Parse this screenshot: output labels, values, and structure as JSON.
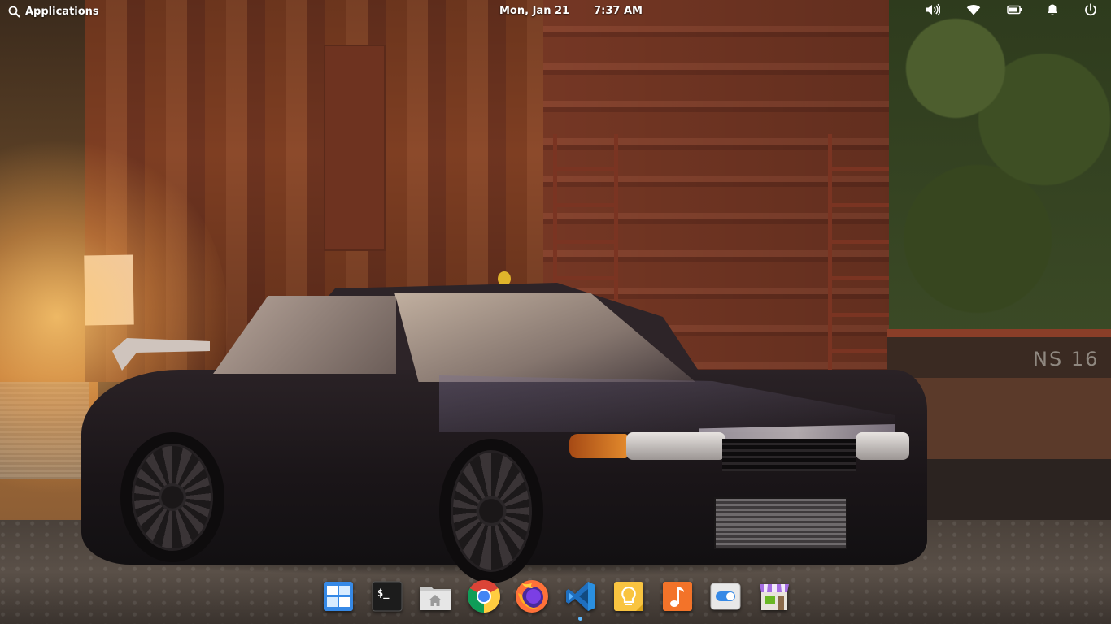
{
  "panel": {
    "applications_label": "Applications",
    "date": "Mon, Jan 21",
    "time": "7:37 AM",
    "indicators": [
      {
        "name": "volume-icon"
      },
      {
        "name": "wifi-icon"
      },
      {
        "name": "battery-icon"
      },
      {
        "name": "notifications-bell-icon"
      },
      {
        "name": "power-icon"
      }
    ]
  },
  "wallpaper": {
    "boxcar_marking": "NS 16"
  },
  "dock": {
    "items": [
      {
        "name": "multitasking-view",
        "icon": "multitasking-icon"
      },
      {
        "name": "terminal",
        "icon": "terminal-icon",
        "glyph": "$_"
      },
      {
        "name": "files",
        "icon": "files-home-folder-icon"
      },
      {
        "name": "google-chrome",
        "icon": "chrome-icon"
      },
      {
        "name": "firefox",
        "icon": "firefox-icon"
      },
      {
        "name": "visual-studio-code",
        "icon": "vscode-icon",
        "running": true
      },
      {
        "name": "ideas",
        "icon": "lightbulb-icon"
      },
      {
        "name": "music",
        "icon": "music-note-icon"
      },
      {
        "name": "system-settings",
        "icon": "toggle-switch-icon"
      },
      {
        "name": "appcenter",
        "icon": "appcenter-store-icon"
      }
    ]
  },
  "colors": {
    "accent_blue": "#3689e6",
    "panel_text": "#ffffff",
    "running_indicator": "#5db8ff"
  }
}
